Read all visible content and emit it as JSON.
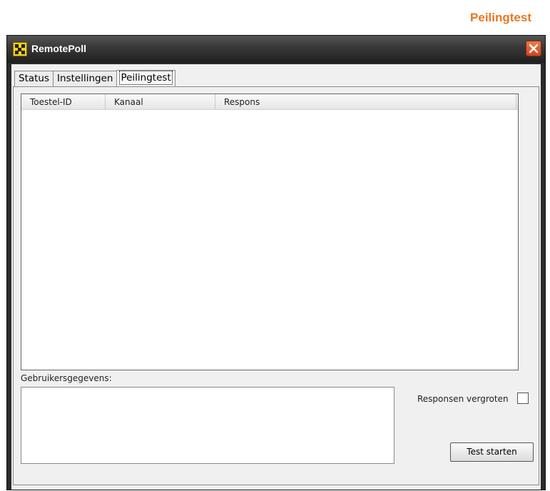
{
  "page": {
    "heading": "Peilingtest"
  },
  "window": {
    "title": "RemotePoll",
    "accent": "#e87722"
  },
  "tabs": [
    {
      "label": "Status"
    },
    {
      "label": "Instellingen"
    },
    {
      "label": "Peilingtest",
      "active": true
    }
  ],
  "list": {
    "columns": [
      "Toestel-ID",
      "Kanaal",
      "Respons"
    ],
    "rows": []
  },
  "form": {
    "user_data_label": "Gebruikersgegevens:",
    "user_data_value": "",
    "enlarge_label": "Responsen vergroten",
    "enlarge_checked": false,
    "start_button": "Test starten"
  },
  "icons": {
    "app": "remotepoll-app-icon",
    "close": "close-icon"
  }
}
